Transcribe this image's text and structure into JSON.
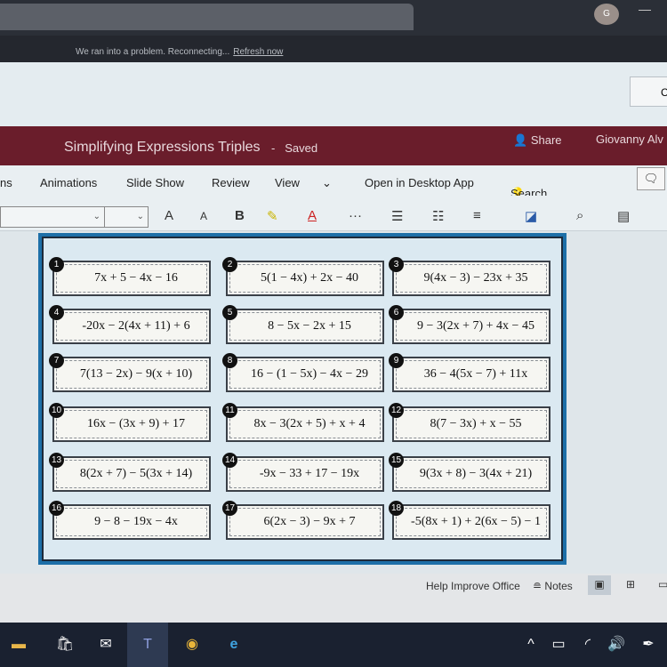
{
  "browser": {
    "avatar": "G"
  },
  "notice": {
    "message": "We ran into a problem. Reconnecting...",
    "link": "Refresh now"
  },
  "header": {
    "button_label": "C"
  },
  "titlebar": {
    "title": "Simplifying Expressions Triples",
    "separator": "-",
    "status": "Saved",
    "share": "Share",
    "user": "Giovanny Alv"
  },
  "ribbon": {
    "tabs": [
      "ns",
      "Animations",
      "Slide Show",
      "Review",
      "View"
    ],
    "more": "⌄",
    "open_desktop": "Open in Desktop App",
    "search": "Search"
  },
  "toolbar": {
    "grow": "A",
    "shrink": "A",
    "bold": "B",
    "more": "···"
  },
  "slide": {
    "cards": [
      {
        "n": "1",
        "expr": "7x + 5 − 4x − 16"
      },
      {
        "n": "2",
        "expr": "5(1 − 4x) + 2x − 40"
      },
      {
        "n": "3",
        "expr": "9(4x − 3) − 23x + 35"
      },
      {
        "n": "4",
        "expr": "-20x − 2(4x + 11) + 6"
      },
      {
        "n": "5",
        "expr": "8 − 5x − 2x + 15"
      },
      {
        "n": "6",
        "expr": "9 − 3(2x + 7) + 4x − 45"
      },
      {
        "n": "7",
        "expr": "7(13 − 2x) − 9(x + 10)"
      },
      {
        "n": "8",
        "expr": "16 − (1 − 5x) − 4x − 29"
      },
      {
        "n": "9",
        "expr": "36 − 4(5x − 7) + 11x"
      },
      {
        "n": "10",
        "expr": "16x − (3x + 9) + 17"
      },
      {
        "n": "11",
        "expr": "8x − 3(2x + 5) + x + 4"
      },
      {
        "n": "12",
        "expr": "8(7 − 3x) + x − 55"
      },
      {
        "n": "13",
        "expr": "8(2x + 7) − 5(3x + 14)"
      },
      {
        "n": "14",
        "expr": "-9x − 33 + 17 − 19x"
      },
      {
        "n": "15",
        "expr": "9(3x + 8) − 3(4x + 21)"
      },
      {
        "n": "16",
        "expr": "9 − 8 − 19x − 4x"
      },
      {
        "n": "17",
        "expr": "6(2x − 3) − 9x + 7"
      },
      {
        "n": "18",
        "expr": "-5(8x + 1) + 2(6x − 5) − 1"
      }
    ]
  },
  "status": {
    "help": "Help Improve Office",
    "notes": "Notes"
  },
  "colors": {
    "title_bar": "#6a1d2b",
    "slide_border": "#1d6fa8",
    "taskbar": "#1a2130"
  }
}
